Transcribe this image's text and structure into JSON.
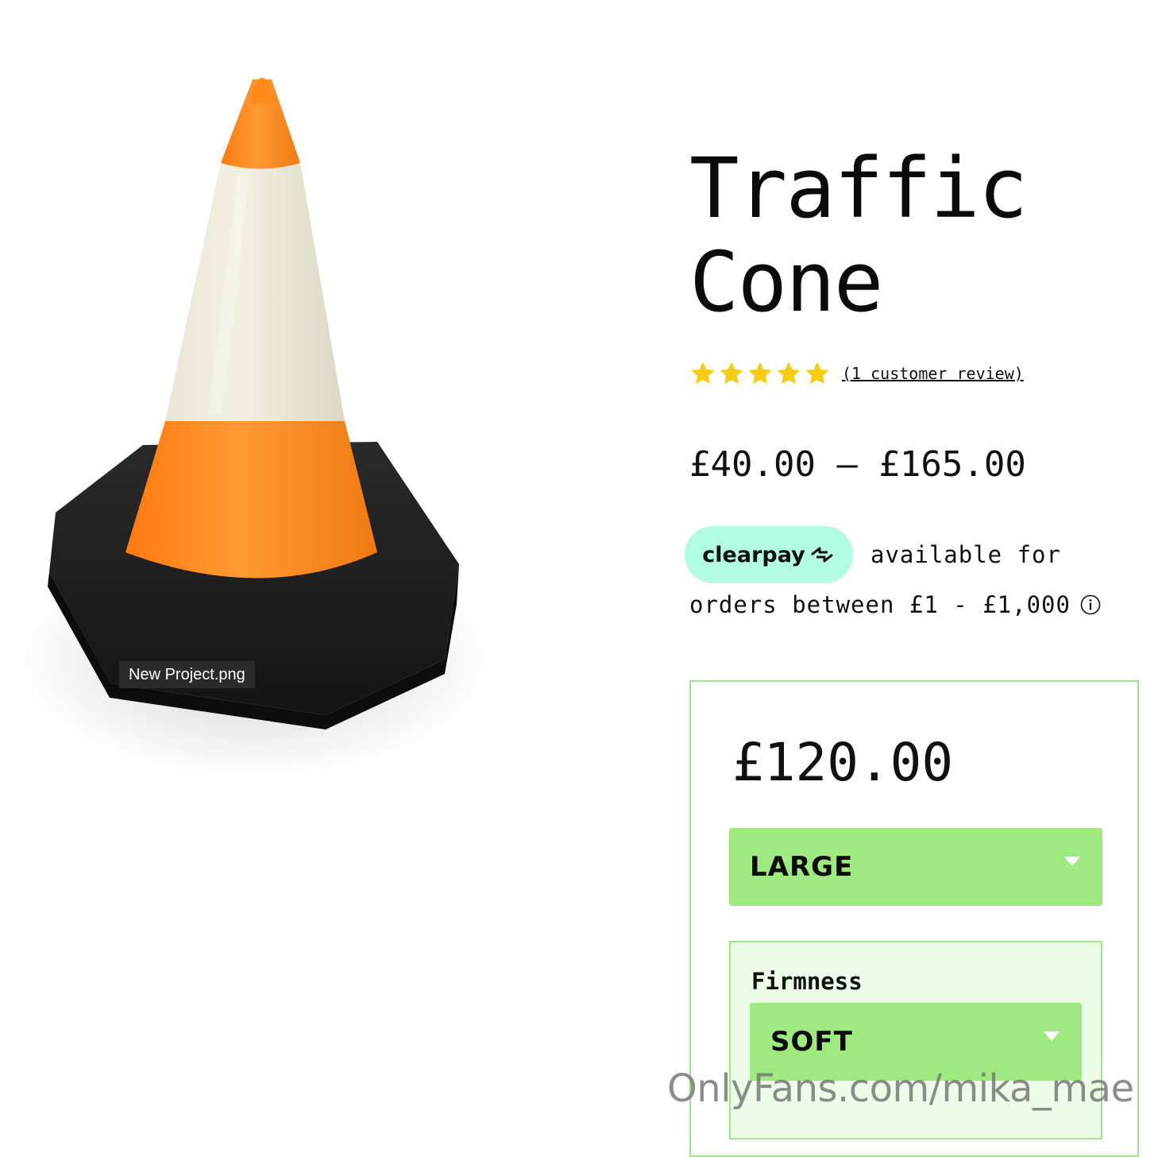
{
  "product": {
    "image_filename": "New Project.png",
    "title_line1": "Traffic",
    "title_line2": "Cone",
    "rating": {
      "stars": 5,
      "max": 5,
      "review_link": "(1 customer review)"
    },
    "price_range": "£40.00 – £165.00"
  },
  "clearpay": {
    "logo_text": "clearpay",
    "text_line1": "available for",
    "text_line2": "orders between £1 - £1,000",
    "info_icon": "info-circle-icon"
  },
  "purchase": {
    "current_price": "£120.00",
    "size_select": {
      "value": "LARGE"
    },
    "firmness": {
      "label": "Firmness",
      "value": "SOFT"
    }
  },
  "watermark": "OnlyFans.com/mika_mae",
  "colors": {
    "accent_green": "#9eea80",
    "panel_border": "#9fe38a",
    "clearpay_mint": "#b2fce4",
    "star_yellow": "#f7cc12",
    "cone_orange": "#ff8a1c"
  }
}
